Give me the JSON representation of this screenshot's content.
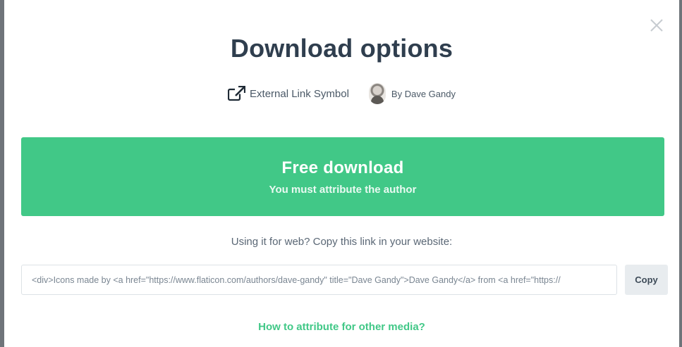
{
  "modal": {
    "title": "Download options",
    "icon_name": "External Link Symbol",
    "author": "By Dave Gandy",
    "download": {
      "main_label": "Free download",
      "sub_label": "You must attribute the author"
    },
    "web_note": "Using it for web? Copy this link in your website:",
    "embed_value": "<div>Icons made by <a href=\"https://www.flaticon.com/authors/dave-gandy\" title=\"Dave Gandy\">Dave Gandy</a> from <a href=\"https://",
    "copy_label": "Copy",
    "attribution_link": "How to attribute for other media?"
  },
  "colors": {
    "accent": "#41c887",
    "title": "#2f3e4e"
  },
  "icons": [
    "close-icon",
    "external-link-icon"
  ]
}
